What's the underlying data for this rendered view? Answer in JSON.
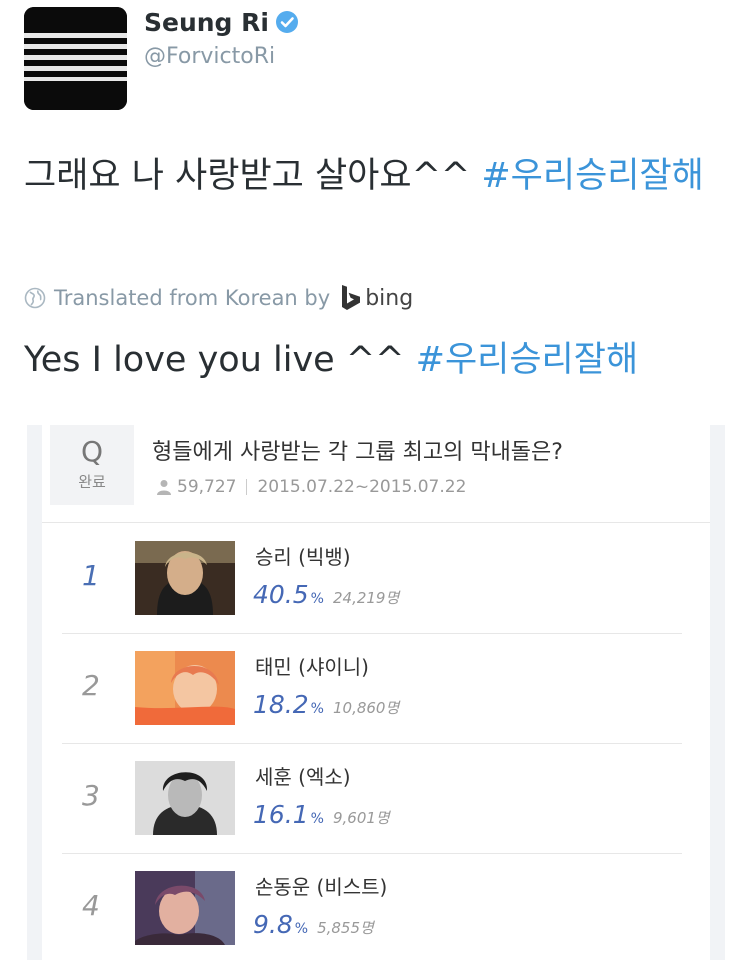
{
  "profile": {
    "display_name": "Seung Ri",
    "handle": "@ForvictoRi",
    "verified": true
  },
  "tweet": {
    "text": "그래요 나 사랑받고 살아요^^ ",
    "hashtag": "#우리승리잘해"
  },
  "translation": {
    "notice": "Translated from Korean by",
    "provider": "bing",
    "text": "Yes I love you live ^^ ",
    "hashtag": "#우리승리잘해"
  },
  "poll": {
    "q_letter": "Q",
    "status": "완료",
    "question": "형들에게 사랑받는 각 그룹 최고의 막내돌은?",
    "participants": "59,727",
    "period": "2015.07.22~2015.07.22",
    "results": [
      {
        "rank": "1",
        "name": "승리 (빅뱅)",
        "percent": "40.5",
        "pct_sign": "%",
        "votes": "24,219명"
      },
      {
        "rank": "2",
        "name": "태민 (샤이니)",
        "percent": "18.2",
        "pct_sign": "%",
        "votes": "10,860명"
      },
      {
        "rank": "3",
        "name": "세훈 (엑소)",
        "percent": "16.1",
        "pct_sign": "%",
        "votes": "9,601명"
      },
      {
        "rank": "4",
        "name": "손동운 (비스트)",
        "percent": "9.8",
        "pct_sign": "%",
        "votes": "5,855명"
      }
    ]
  },
  "colors": {
    "link": "#3b94d9",
    "verified_badge": "#55acee",
    "poll_percent": "#4568b5"
  }
}
